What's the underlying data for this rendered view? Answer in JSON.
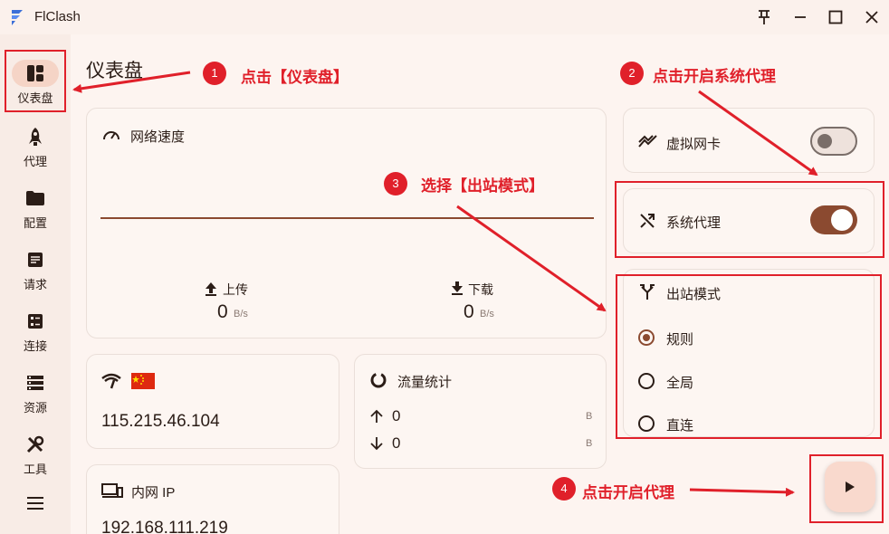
{
  "window": {
    "title": "FlClash"
  },
  "sidebar": {
    "items": [
      {
        "label": "仪表盘",
        "icon": "dashboard-icon",
        "active": true
      },
      {
        "label": "代理",
        "icon": "rocket-icon"
      },
      {
        "label": "配置",
        "icon": "folder-icon"
      },
      {
        "label": "请求",
        "icon": "request-icon"
      },
      {
        "label": "连接",
        "icon": "connections-icon"
      },
      {
        "label": "资源",
        "icon": "storage-icon"
      },
      {
        "label": "工具",
        "icon": "tools-icon"
      }
    ],
    "menu_icon": "menu-icon"
  },
  "main": {
    "page_title": "仪表盘",
    "network_speed": {
      "title": "网络速度",
      "upload_label": "上传",
      "upload_value": "0",
      "upload_unit": "B/s",
      "download_label": "下载",
      "download_value": "0",
      "download_unit": "B/s"
    },
    "ip_card": {
      "ip": "115.215.46.104",
      "flag": "CN"
    },
    "traffic": {
      "title": "流量统计",
      "up_value": "0",
      "up_unit": "B",
      "down_value": "0",
      "down_unit": "B"
    },
    "intranet": {
      "title": "内网 IP",
      "value": "192.168.111.219"
    },
    "tun": {
      "label": "虚拟网卡",
      "enabled": false
    },
    "system_proxy": {
      "label": "系统代理",
      "enabled": true
    },
    "outbound": {
      "title": "出站模式",
      "options": [
        "规则",
        "全局",
        "直连"
      ],
      "selected": "规则"
    }
  },
  "annotations": [
    {
      "number": "1",
      "text": "点击【仪表盘】"
    },
    {
      "number": "2",
      "text": "点击开启系统代理"
    },
    {
      "number": "3",
      "text": "选择【出站模式】"
    },
    {
      "number": "4",
      "text": "点击开启代理"
    }
  ],
  "colors": {
    "accent": "#8b4a30",
    "annotation_red": "#e0202a",
    "background": "#fdf4f0"
  }
}
